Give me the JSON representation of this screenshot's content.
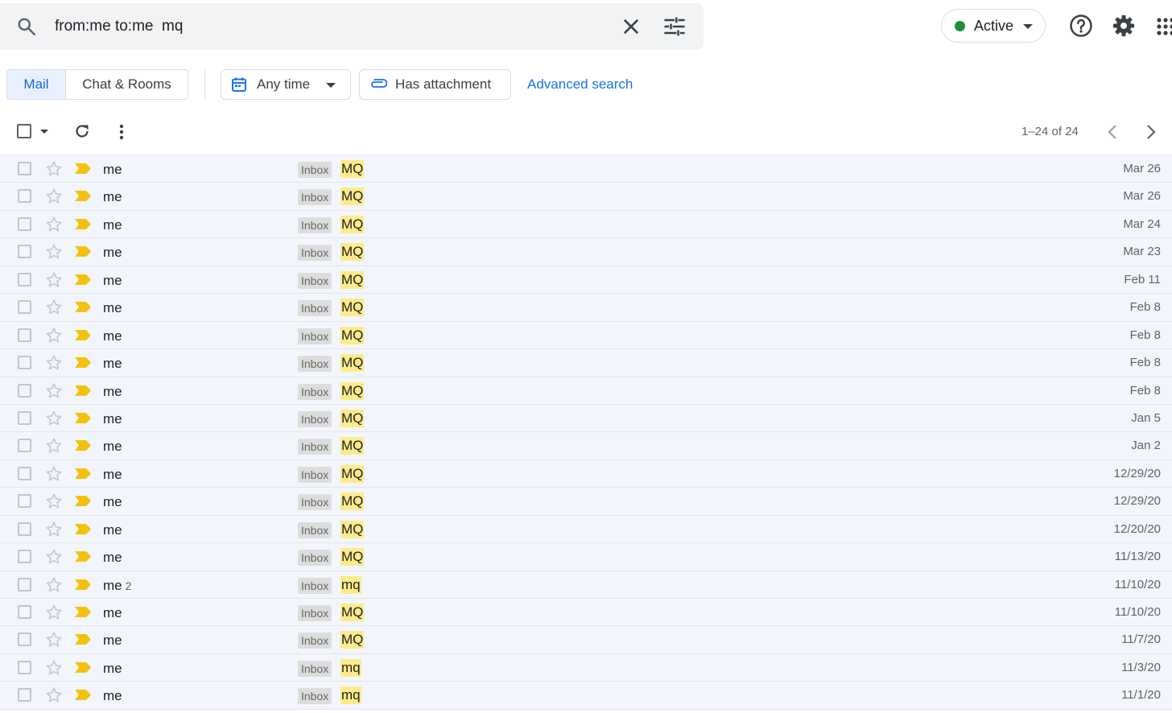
{
  "search": {
    "query": "from:me to:me  mq",
    "search_icon": "search-icon",
    "clear_icon": "close-icon",
    "options_icon": "tune-icon"
  },
  "header": {
    "status_label": "Active",
    "status_color": "#1e8e3e",
    "help_icon": "help-icon",
    "settings_icon": "gear-icon",
    "apps_icon": "apps-grid-icon"
  },
  "filters": {
    "segments": [
      "Mail",
      "Chat & Rooms"
    ],
    "selected_segment": "Mail",
    "time_chip": "Any time",
    "attachment_chip": "Has attachment",
    "advanced_search": "Advanced search"
  },
  "toolbar": {
    "page_range": "1–24 of 24"
  },
  "colors": {
    "accent": "#1a73e8",
    "highlight": "#fdeb8b",
    "important_marker": "#f4c20d",
    "row_background": "#f2f6fc"
  },
  "messages": [
    {
      "sender": "me",
      "count": "",
      "label": "Inbox",
      "subject": "MQ",
      "date": "Mar 26"
    },
    {
      "sender": "me",
      "count": "",
      "label": "Inbox",
      "subject": "MQ",
      "date": "Mar 26"
    },
    {
      "sender": "me",
      "count": "",
      "label": "Inbox",
      "subject": "MQ",
      "date": "Mar 24"
    },
    {
      "sender": "me",
      "count": "",
      "label": "Inbox",
      "subject": "MQ",
      "date": "Mar 23"
    },
    {
      "sender": "me",
      "count": "",
      "label": "Inbox",
      "subject": "MQ",
      "date": "Feb 11"
    },
    {
      "sender": "me",
      "count": "",
      "label": "Inbox",
      "subject": "MQ",
      "date": "Feb 8"
    },
    {
      "sender": "me",
      "count": "",
      "label": "Inbox",
      "subject": "MQ",
      "date": "Feb 8"
    },
    {
      "sender": "me",
      "count": "",
      "label": "Inbox",
      "subject": "MQ",
      "date": "Feb 8"
    },
    {
      "sender": "me",
      "count": "",
      "label": "Inbox",
      "subject": "MQ",
      "date": "Feb 8"
    },
    {
      "sender": "me",
      "count": "",
      "label": "Inbox",
      "subject": "MQ",
      "date": "Jan 5"
    },
    {
      "sender": "me",
      "count": "",
      "label": "Inbox",
      "subject": "MQ",
      "date": "Jan 2"
    },
    {
      "sender": "me",
      "count": "",
      "label": "Inbox",
      "subject": "MQ",
      "date": "12/29/20"
    },
    {
      "sender": "me",
      "count": "",
      "label": "Inbox",
      "subject": "MQ",
      "date": "12/29/20"
    },
    {
      "sender": "me",
      "count": "",
      "label": "Inbox",
      "subject": "MQ",
      "date": "12/20/20"
    },
    {
      "sender": "me",
      "count": "",
      "label": "Inbox",
      "subject": "MQ",
      "date": "11/13/20"
    },
    {
      "sender": "me",
      "count": "2",
      "label": "Inbox",
      "subject": "mq",
      "date": "11/10/20"
    },
    {
      "sender": "me",
      "count": "",
      "label": "Inbox",
      "subject": "MQ",
      "date": "11/10/20"
    },
    {
      "sender": "me",
      "count": "",
      "label": "Inbox",
      "subject": "MQ",
      "date": "11/7/20"
    },
    {
      "sender": "me",
      "count": "",
      "label": "Inbox",
      "subject": "mq",
      "date": "11/3/20"
    },
    {
      "sender": "me",
      "count": "",
      "label": "Inbox",
      "subject": "mq",
      "date": "11/1/20"
    }
  ]
}
